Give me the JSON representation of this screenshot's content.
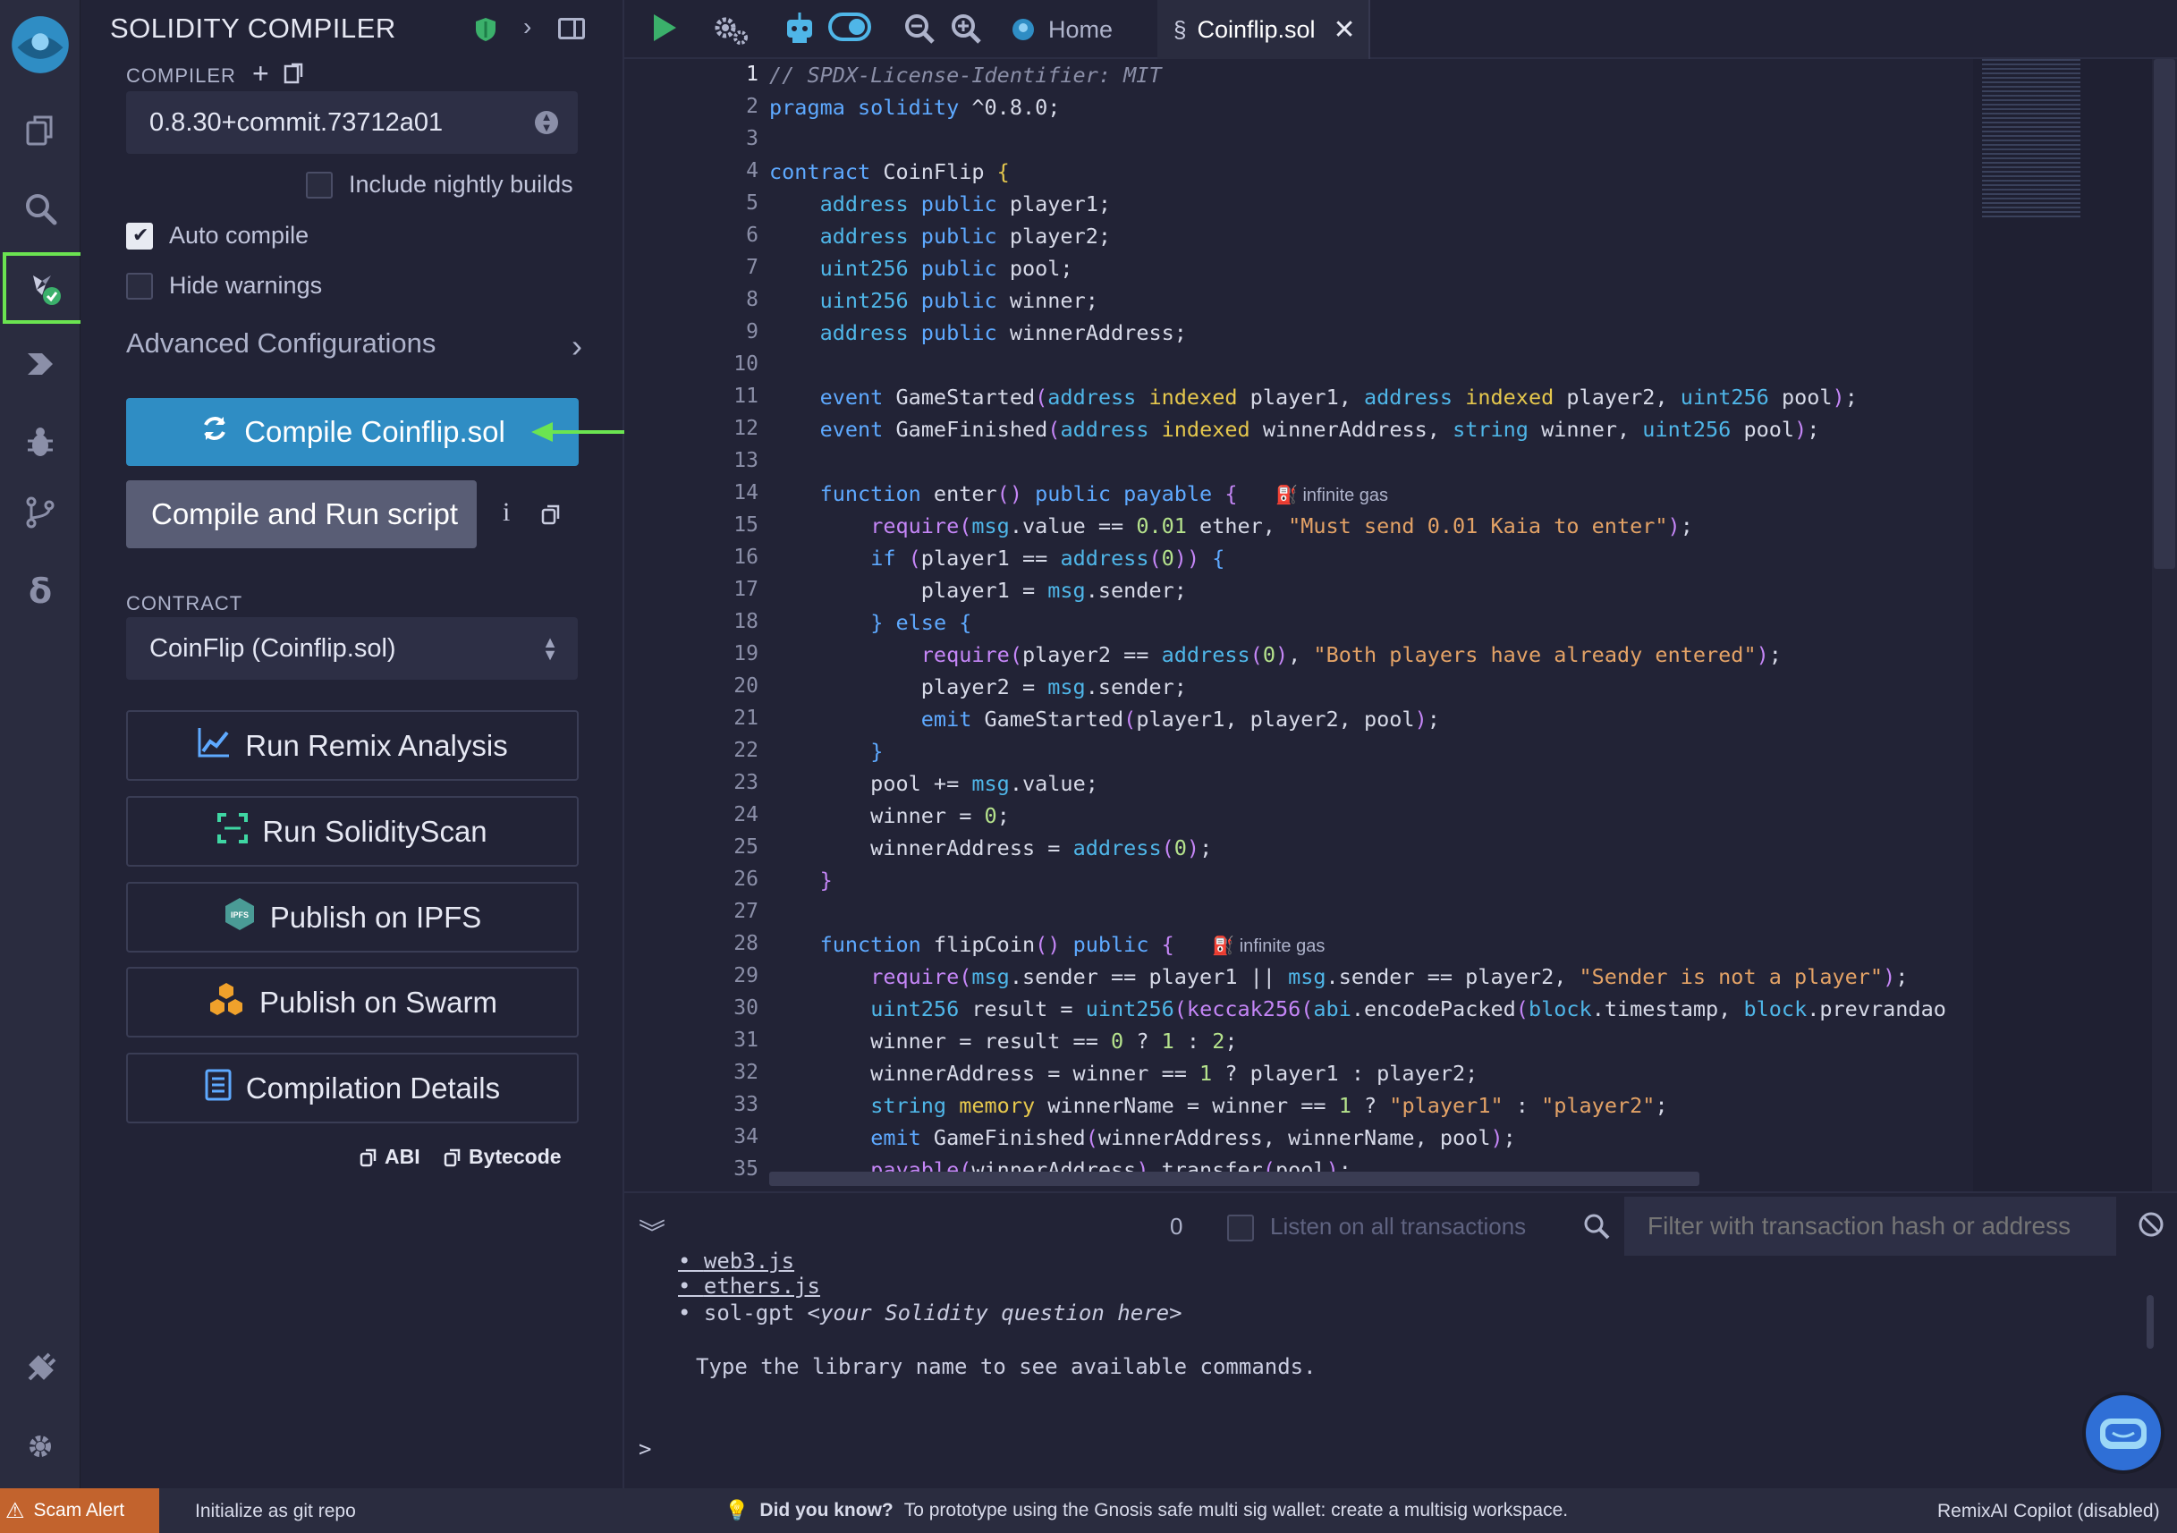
{
  "panel": {
    "title": "SOLIDITY COMPILER",
    "compiler_label": "COMPILER",
    "compiler_version": "0.8.30+commit.73712a01",
    "nightly_label": "Include nightly builds",
    "auto_compile_label": "Auto compile",
    "hide_warnings_label": "Hide warnings",
    "advanced_label": "Advanced Configurations",
    "compile_button": "Compile Coinflip.sol",
    "compile_run_button": "Compile and Run script",
    "contract_label": "CONTRACT",
    "contract_value": "CoinFlip (Coinflip.sol)",
    "run_analysis": "Run Remix Analysis",
    "run_solidityscan": "Run SolidityScan",
    "publish_ipfs": "Publish on IPFS",
    "publish_swarm": "Publish on Swarm",
    "compilation_details": "Compilation Details",
    "abi_label": "ABI",
    "bytecode_label": "Bytecode",
    "info_glyph": "i",
    "ipfs_badge": "IPFS"
  },
  "tabs": {
    "home": "Home",
    "file": "Coinflip.sol"
  },
  "editor": {
    "line_numbers": [
      "1",
      "2",
      "3",
      "4",
      "5",
      "6",
      "7",
      "8",
      "9",
      "10",
      "11",
      "12",
      "13",
      "14",
      "15",
      "16",
      "17",
      "18",
      "19",
      "20",
      "21",
      "22",
      "23",
      "24",
      "25",
      "26",
      "27",
      "28",
      "29",
      "30",
      "31",
      "32",
      "33",
      "34",
      "35"
    ],
    "gas_hint": "infinite gas"
  },
  "terminal": {
    "counter": "0",
    "listen_label": "Listen on all transactions",
    "filter_placeholder": "Filter with transaction hash or address",
    "lines": [
      "web3.js",
      "ethers.js",
      "sol-gpt "
    ],
    "sol_gpt_hint": "<your Solidity question here>",
    "hint": "Type the library name to see available commands.",
    "prompt": ">"
  },
  "statusbar": {
    "scam_alert": "Scam Alert",
    "git": "Initialize as git repo",
    "did_you_know": "Did you know?",
    "tip": "To prototype using the Gnosis safe multi sig wallet: create a multisig workspace.",
    "copilot": "RemixAI Copilot (disabled)"
  },
  "colors": {
    "accent": "#2f8dc4",
    "highlight": "#6be451",
    "scam": "#c2632d"
  }
}
